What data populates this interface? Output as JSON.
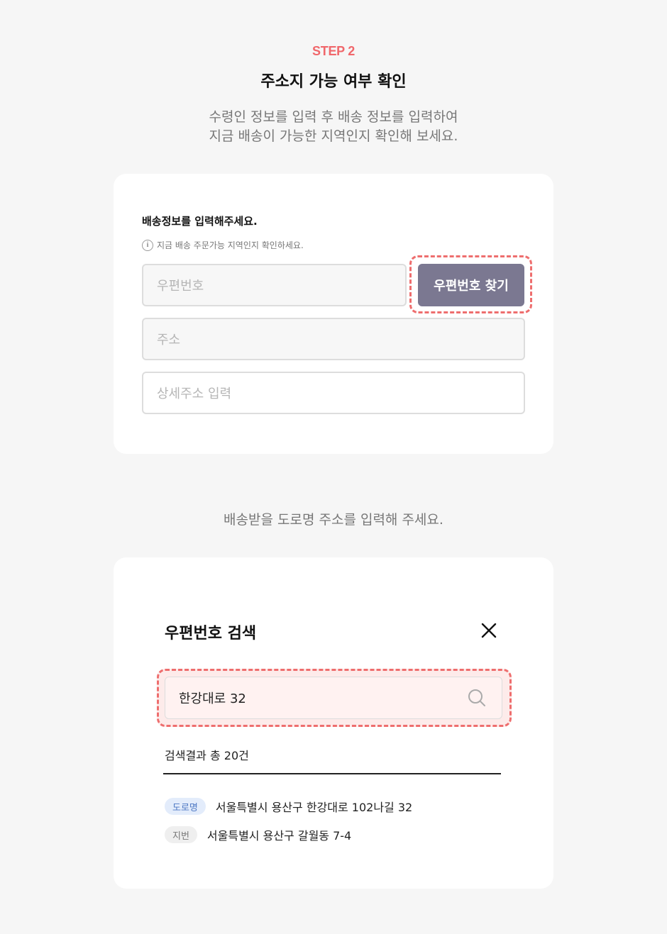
{
  "step": {
    "label": "STEP 2",
    "title": "주소지 가능 여부 확인",
    "desc_line1": "수령인 정보를 입력 후 배송 정보를 입력하여",
    "desc_line2": "지금 배송이 가능한 지역인지 확인해 보세요."
  },
  "form": {
    "title": "배송정보를 입력해주세요.",
    "note": "지금 배송 주문가능 지역인지 확인하세요.",
    "zip_placeholder": "우편번호",
    "zip_button": "우편번호 찾기",
    "address_placeholder": "주소",
    "detail_placeholder": "상세주소 입력"
  },
  "guide": "배송받을 도로명 주소를 입력해 주세요.",
  "modal": {
    "title": "우편번호 검색",
    "search_value": "한강대로 32",
    "result_count": "검색결과 총 20건",
    "results": [
      {
        "badge": "도로명",
        "text": "서울특별시 용산구 한강대로 102나길 32"
      },
      {
        "badge": "지번",
        "text": "서울특별시 용산구 갈월동 7-4"
      }
    ]
  },
  "colors": {
    "accent": "#f0676b",
    "button": "#7b7891",
    "highlight": "#ee6e6e"
  }
}
